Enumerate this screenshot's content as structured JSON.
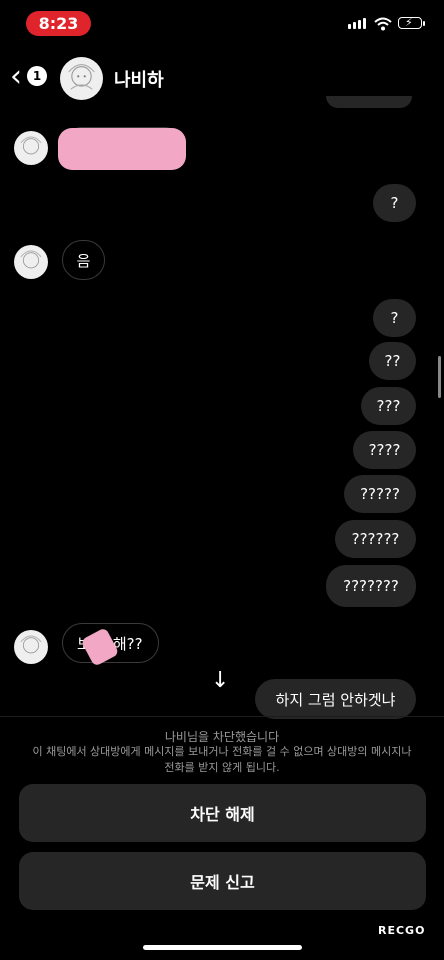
{
  "status_bar": {
    "time": "8:23"
  },
  "header": {
    "unread_count": "1",
    "contact_name": "나비하"
  },
  "messages": {
    "sent_q1": "?",
    "received_um": "음",
    "sent_q2": "?",
    "sent_q3": "??",
    "sent_q4": "???",
    "sent_q5": "????",
    "sent_q6": "?????",
    "sent_q7": "??????",
    "sent_q8": "???????",
    "received_partial_visible": "해??",
    "received_partial_prefix": "보",
    "sent_last": "하지 그럼 안하겟냐"
  },
  "blocked_panel": {
    "title": "나비님을 차단했습니다",
    "description": "이 채팅에서 상대방에게 메시지를 보내거나 전화를 걸 수 없으며 상대방의 메시지나 전화를 받지 않게 됩니다.",
    "unblock_button": "차단 해제",
    "report_button": "문제 신고"
  },
  "watermark": "RECGO"
}
